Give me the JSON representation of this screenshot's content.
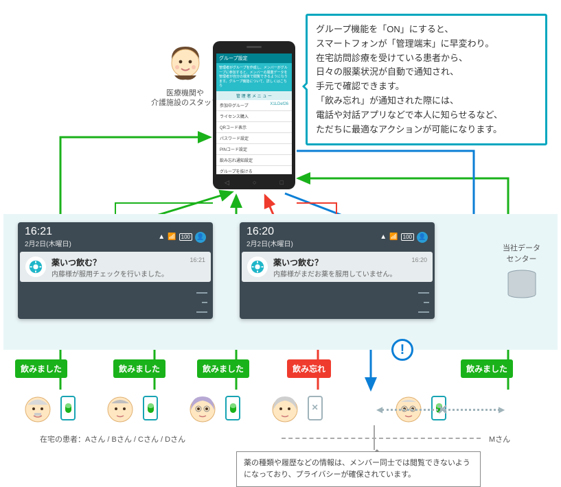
{
  "speech": {
    "l1": "グループ機能を「ON」にすると、",
    "l2": "スマートフォンが「管理端末」に早変わり。",
    "l3": "在宅訪問診療を受けている患者から、",
    "l4": "日々の服薬状況が自動で通知され、",
    "l5": "手元で確認できます。",
    "l6": "「飲み忘れ」が通知された際には、",
    "l7": "電話や対話アプリなどで本人に知らせるなど、",
    "l8": "ただちに最適なアクションが可能になります。"
  },
  "staff_label_l1": "医療機関や",
  "staff_label_l2": "介護施設のスタッフ",
  "phone": {
    "topbar": "グループ設定",
    "banner": "管理者がグループを作成し、メンバーがグループに参加すると、メンバーの服薬データを管理者が自分の端末で閲覧できるようになります。グループ機能について、詳しくはこちら",
    "menu_header": "管 理 者 メ ニ ュ ー",
    "items": [
      {
        "label": "参加中グループ",
        "value": "X1LDef26"
      },
      {
        "label": "ライセンス購入",
        "value": ""
      },
      {
        "label": "QRコード表示",
        "value": ""
      },
      {
        "label": "パスワード設定",
        "value": ""
      },
      {
        "label": "PINコード設定",
        "value": ""
      },
      {
        "label": "飲み忘れ通知設定",
        "value": ""
      },
      {
        "label": "グループを抜ける",
        "value": ""
      }
    ]
  },
  "notif_left": {
    "time": "16:21",
    "date": "2月2日(木曜日)",
    "battery": "100",
    "title": "薬いつ飲む？",
    "msg": "内藤様が服用チェックを行いました。",
    "ts": "16:21"
  },
  "notif_right": {
    "time": "16:20",
    "date": "2月2日(木曜日)",
    "battery": "100",
    "title": "薬いつ飲む？",
    "msg": "内藤様がまだお薬を服用していません。",
    "ts": "16:20"
  },
  "datacenter_l1": "当社データ",
  "datacenter_l2": "センター",
  "tags": {
    "t1": "飲みました",
    "t2": "飲みました",
    "t3": "飲みました",
    "t4": "飲み忘れ",
    "t5": "飲みました"
  },
  "patients_label": "在宅の患者：Aさん / Bさん / Cさん / Dさん",
  "patient_m": "Mさん",
  "privacy": "薬の種類や履歴などの情報は、メンバー同士では閲覧できないようになっており、プライバシーが確保されています。",
  "alert_mark": "!",
  "cross": "✕",
  "colors": {
    "teal": "#00a6bf",
    "green": "#1ab21a",
    "red": "#ef3b2d",
    "blue": "#0b7fd6"
  }
}
